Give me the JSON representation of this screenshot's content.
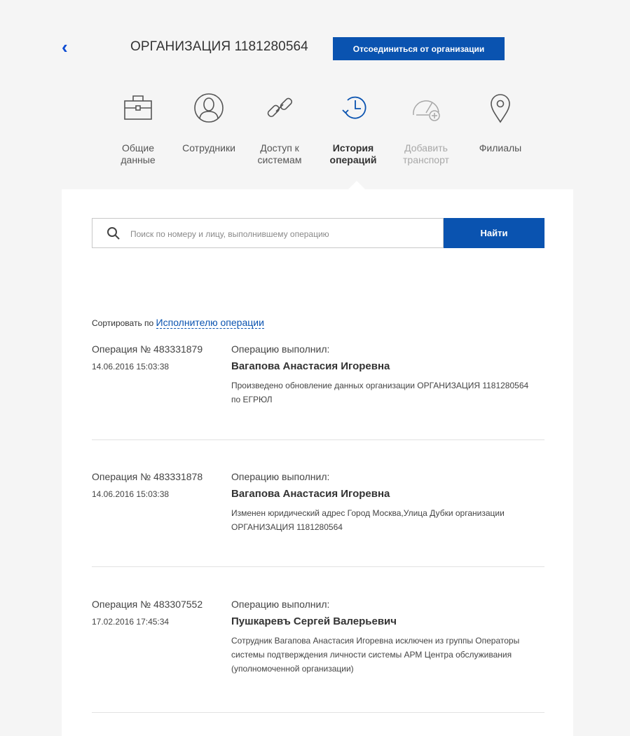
{
  "header": {
    "title": "ОРГАНИЗАЦИЯ 1181280564",
    "disconnect_label": "Отсоединиться от организации"
  },
  "tabs": [
    {
      "label": "Общие\nданные",
      "icon": "briefcase-icon",
      "state": "normal"
    },
    {
      "label": "Сотрудники",
      "icon": "person-icon",
      "state": "normal"
    },
    {
      "label": "Доступ к\nсистемам",
      "icon": "link-icon",
      "state": "normal"
    },
    {
      "label": "История\nопераций",
      "icon": "history-icon",
      "state": "active"
    },
    {
      "label": "Добавить\nтранспорт",
      "icon": "speedometer-add-icon",
      "state": "disabled"
    },
    {
      "label": "Филиалы",
      "icon": "location-pin-icon",
      "state": "normal"
    }
  ],
  "search": {
    "placeholder": "Поиск по номеру и лицу, выполнившему операцию",
    "value": "",
    "button_label": "Найти"
  },
  "sort": {
    "prefix": "Сортировать по",
    "link": "Исполнителю операции"
  },
  "operations": [
    {
      "number": "Операция № 483331879",
      "datetime": "14.06.2016 15:03:38",
      "by_label": "Операцию выполнил:",
      "performer": "Вагапова Анастасия Игоревна",
      "description": "Произведено обновление данных организации ОРГАНИЗАЦИЯ 1181280564 по ЕГРЮЛ"
    },
    {
      "number": "Операция № 483331878",
      "datetime": "14.06.2016 15:03:38",
      "by_label": "Операцию выполнил:",
      "performer": "Вагапова Анастасия Игоревна",
      "description": "Изменен юридический адрес Город Москва,Улица Дубки организации ОРГАНИЗАЦИЯ 1181280564"
    },
    {
      "number": "Операция № 483307552",
      "datetime": "17.02.2016 17:45:34",
      "by_label": "Операцию выполнил:",
      "performer": "Пушкаревъ Сергей Валерьевич",
      "description": "Сотрудник Вагапова Анастасия Игоревна исключен из группы Операторы системы подтверждения личности системы АРМ Центра обслуживания (уполномоченной организации)"
    }
  ],
  "colors": {
    "accent": "#0a53b0",
    "background": "#f5f5f5",
    "panel": "#ffffff"
  }
}
